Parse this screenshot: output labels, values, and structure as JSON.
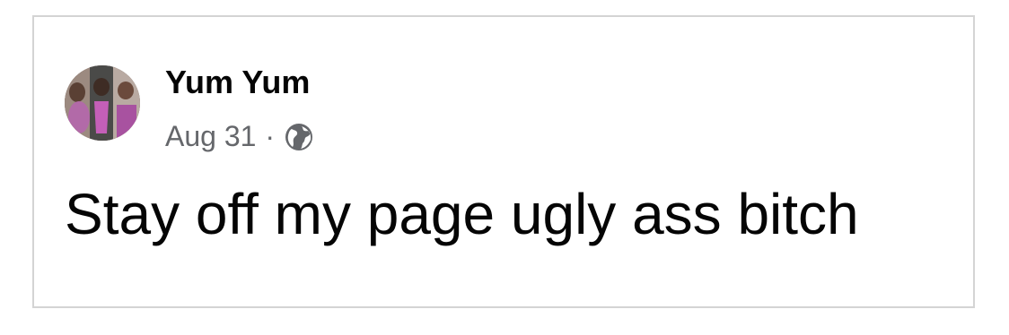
{
  "post": {
    "author": "Yum Yum",
    "date": "Aug 31",
    "separator": "·",
    "audience_icon": "globe-icon",
    "text": "Stay off my page ugly ass bitch"
  },
  "colors": {
    "name": "#050505",
    "meta": "#65676b",
    "border": "#d4d4d4"
  }
}
